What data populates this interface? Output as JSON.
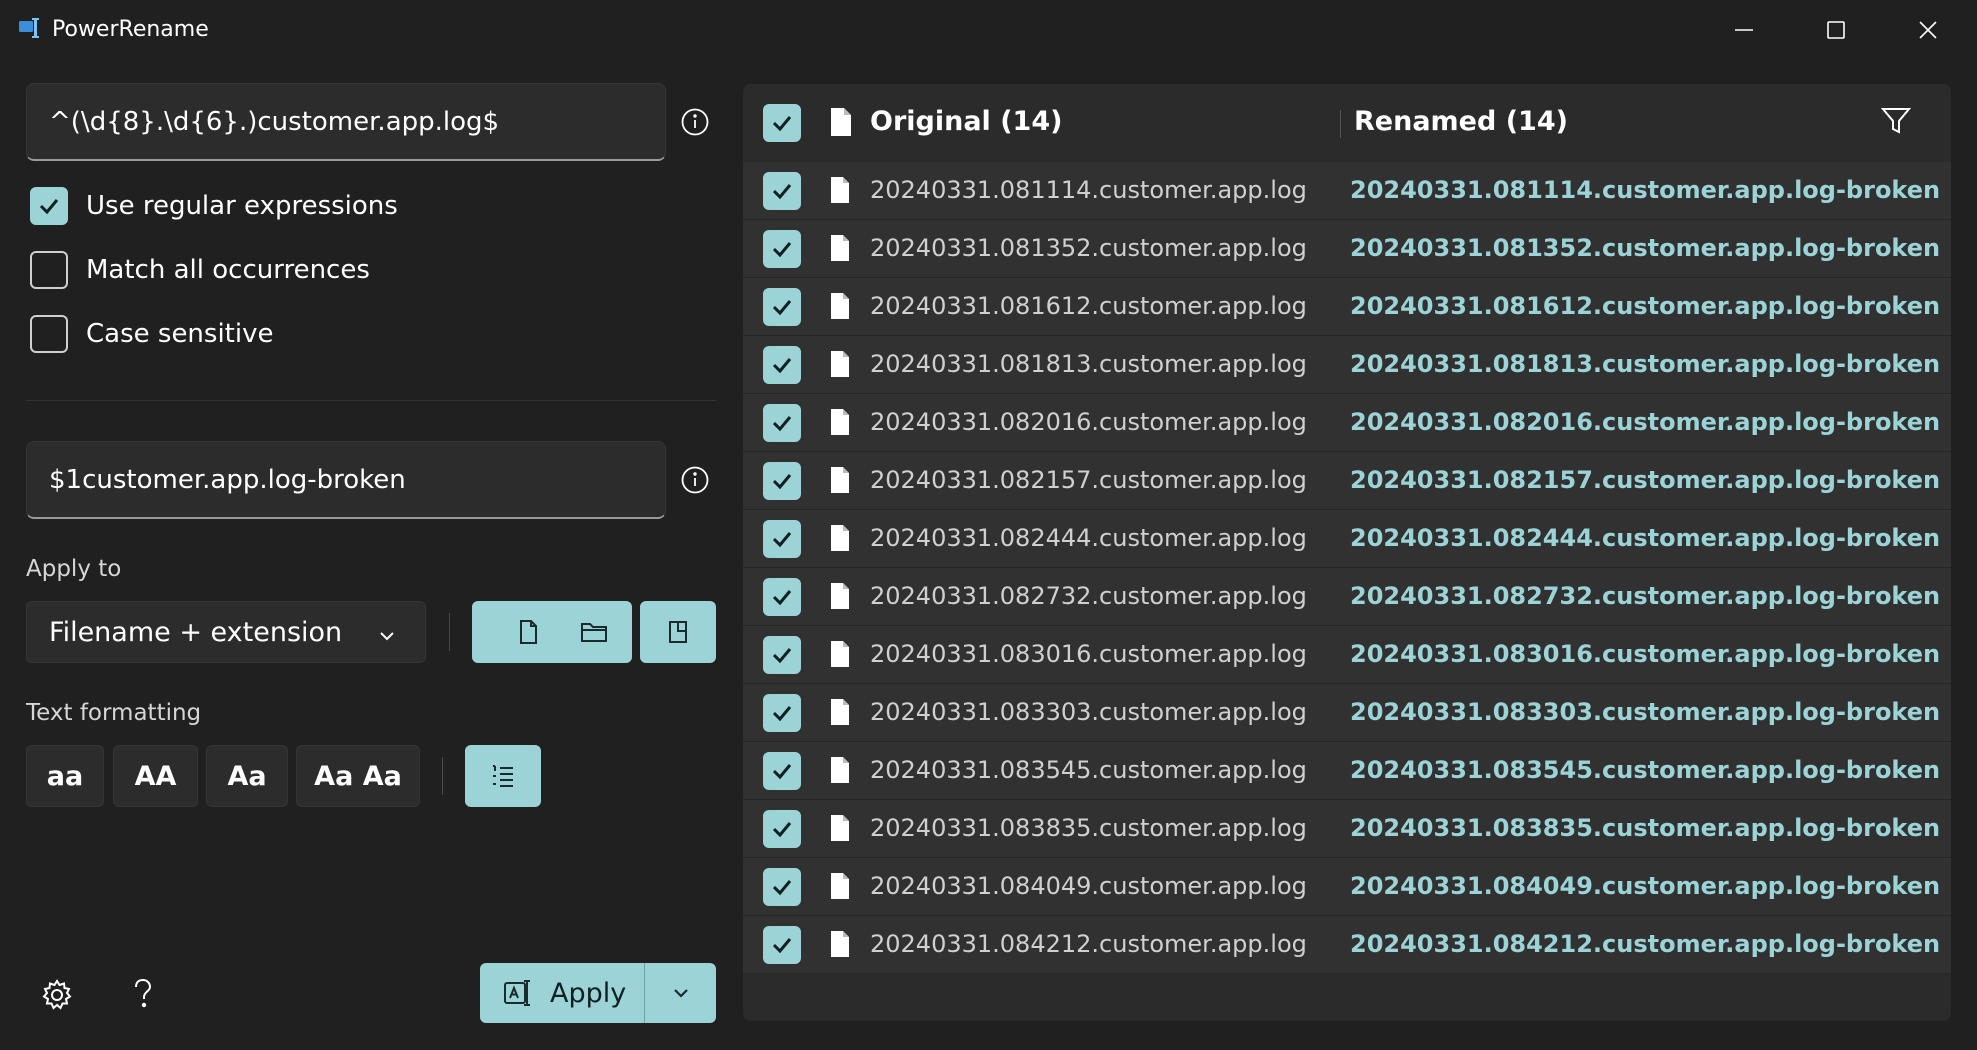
{
  "window": {
    "title": "PowerRename",
    "controls": [
      "minimize",
      "maximize",
      "close"
    ]
  },
  "search": {
    "value": "^(\\d{8}.\\d{6}.)customer.app.log$"
  },
  "options": [
    {
      "label": "Use regular expressions",
      "checked": true
    },
    {
      "label": "Match all occurrences",
      "checked": false
    },
    {
      "label": "Case sensitive",
      "checked": false
    }
  ],
  "replace": {
    "value": "$1customer.app.log-broken"
  },
  "apply_to": {
    "label": "Apply to",
    "selected": "Filename + extension"
  },
  "text_formatting": {
    "label": "Text formatting",
    "buttons": [
      "aa",
      "AA",
      "Aa",
      "Aa Aa"
    ]
  },
  "apply_button": {
    "label": "Apply"
  },
  "list": {
    "header_original": "Original (14)",
    "header_renamed": "Renamed (14)",
    "rows": [
      {
        "original": "20240331.081114.customer.app.log",
        "renamed": "20240331.081114.customer.app.log-broken"
      },
      {
        "original": "20240331.081352.customer.app.log",
        "renamed": "20240331.081352.customer.app.log-broken"
      },
      {
        "original": "20240331.081612.customer.app.log",
        "renamed": "20240331.081612.customer.app.log-broken"
      },
      {
        "original": "20240331.081813.customer.app.log",
        "renamed": "20240331.081813.customer.app.log-broken"
      },
      {
        "original": "20240331.082016.customer.app.log",
        "renamed": "20240331.082016.customer.app.log-broken"
      },
      {
        "original": "20240331.082157.customer.app.log",
        "renamed": "20240331.082157.customer.app.log-broken"
      },
      {
        "original": "20240331.082444.customer.app.log",
        "renamed": "20240331.082444.customer.app.log-broken"
      },
      {
        "original": "20240331.082732.customer.app.log",
        "renamed": "20240331.082732.customer.app.log-broken"
      },
      {
        "original": "20240331.083016.customer.app.log",
        "renamed": "20240331.083016.customer.app.log-broken"
      },
      {
        "original": "20240331.083303.customer.app.log",
        "renamed": "20240331.083303.customer.app.log-broken"
      },
      {
        "original": "20240331.083545.customer.app.log",
        "renamed": "20240331.083545.customer.app.log-broken"
      },
      {
        "original": "20240331.083835.customer.app.log",
        "renamed": "20240331.083835.customer.app.log-broken"
      },
      {
        "original": "20240331.084049.customer.app.log",
        "renamed": "20240331.084049.customer.app.log-broken"
      },
      {
        "original": "20240331.084212.customer.app.log",
        "renamed": "20240331.084212.customer.app.log-broken"
      }
    ]
  },
  "colors": {
    "accent": "#9bd3d6",
    "background": "#202020",
    "panel": "#2b2b2b"
  }
}
